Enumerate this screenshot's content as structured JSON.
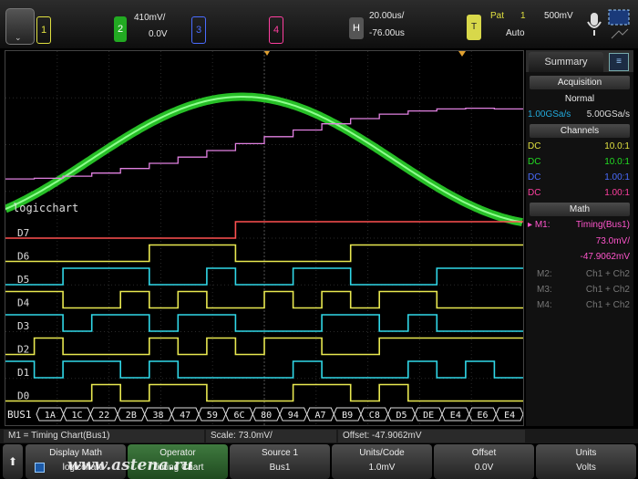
{
  "topbar": {
    "menu_label": "⌄",
    "ch1": {
      "num": "1",
      "color": "#e0e040"
    },
    "ch2": {
      "num": "2",
      "scale": "410mV/",
      "offset": "0.0V",
      "color": "#22dd22"
    },
    "ch3": {
      "num": "3",
      "color": "#4a6cff"
    },
    "ch4": {
      "num": "4",
      "color": "#ff3fa0"
    },
    "horizontal": {
      "label": "H",
      "timebase": "20.00us/",
      "delay": "-76.00us"
    },
    "trigger": {
      "label": "T",
      "type": "Pat",
      "source": "1",
      "level": "500mV",
      "mode": "Auto"
    }
  },
  "display": {
    "math_label": "logicchart",
    "digital_labels": [
      "D7",
      "D6",
      "D5",
      "D4",
      "D3",
      "D2",
      "D1",
      "D0"
    ],
    "bus_label": "BUS1",
    "bus_values": [
      "1A",
      "1C",
      "22",
      "2B",
      "38",
      "47",
      "59",
      "6C",
      "80",
      "94",
      "A7",
      "B9",
      "C8",
      "D5",
      "DE",
      "E4",
      "E6",
      "E4"
    ]
  },
  "summary": {
    "tab_label": "Summary",
    "acquisition_title": "Acquisition",
    "acq_mode": "Normal",
    "acq_rate1": "1.00GSa/s",
    "acq_rate2": "5.00GSa/s",
    "channels_title": "Channels",
    "channels": [
      {
        "coupling": "DC",
        "probe": "10.0:1",
        "color": "#e0e040"
      },
      {
        "coupling": "DC",
        "probe": "10.0:1",
        "color": "#22dd22"
      },
      {
        "coupling": "DC",
        "probe": "1.00:1",
        "color": "#4a6cff"
      },
      {
        "coupling": "DC",
        "probe": "1.00:1",
        "color": "#ff3fa0"
      }
    ],
    "math_title": "Math",
    "m1": {
      "name": "M1:",
      "func": "Timing(Bus1)",
      "scale": "73.0mV/",
      "offset": "-47.9062mV"
    },
    "m2": {
      "name": "M2:",
      "func": "Ch1 + Ch2"
    },
    "m3": {
      "name": "M3:",
      "func": "Ch1 + Ch2"
    },
    "m4": {
      "name": "M4:",
      "func": "Ch1 + Ch2"
    }
  },
  "status": {
    "math_def": "M1 = Timing Chart(Bus1)",
    "scale": "Scale: 73.0mV/",
    "offset": "Offset: -47.9062mV"
  },
  "softkeys": [
    {
      "top": "Display Math",
      "bottom": "logicchart"
    },
    {
      "top": "Operator",
      "bottom": "Timing Chart"
    },
    {
      "top": "Source 1",
      "bottom": "Bus1"
    },
    {
      "top": "Units/Code",
      "bottom": "1.0mV"
    },
    {
      "top": "Offset",
      "bottom": "0.0V"
    },
    {
      "top": "Units",
      "bottom": "Volts"
    }
  ],
  "watermark": "www.astena.ru"
}
